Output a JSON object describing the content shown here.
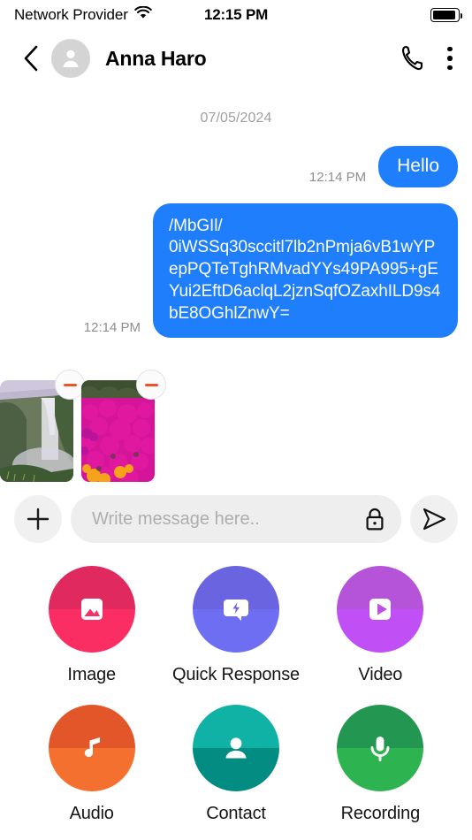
{
  "status_bar": {
    "carrier": "Network Provider",
    "wifi_icon": "wifi-icon",
    "time": "12:15 PM",
    "battery_icon": "battery-icon",
    "battery_level": 92
  },
  "header": {
    "back_icon": "chevron-left-icon",
    "avatar_icon": "person-avatar-icon",
    "contact_name": "Anna Haro",
    "call_icon": "phone-icon",
    "menu_icon": "kebab-menu-icon"
  },
  "conversation": {
    "date_separator": "07/05/2024",
    "messages": [
      {
        "time": "12:14 PM",
        "text": "Hello",
        "direction": "outgoing"
      },
      {
        "time": "12:14 PM",
        "text": "/MbGIl/\n0iWSSq30sccitl7lb2nPmja6vB1wYPepPQTeTghRMvadYYs49PA995+gEYui2EftD6aclqL2jznSqfOZaxhILD9s4bE8OGhlZnwY=",
        "direction": "outgoing"
      }
    ],
    "bubble_color": "#1e7efb",
    "timestamp_color": "#8e8e8e"
  },
  "attachments": {
    "items": [
      {
        "name": "waterfall-photo",
        "remove_icon": "minus-circle-icon"
      },
      {
        "name": "pink-flowers-photo",
        "remove_icon": "minus-circle-icon"
      }
    ],
    "remove_color": "#f0502a"
  },
  "composer": {
    "add_icon": "plus-icon",
    "input_value": "",
    "placeholder": "Write message here..",
    "lock_icon": "lock-icon",
    "send_icon": "send-paper-plane-icon"
  },
  "action_sheet": {
    "items": [
      {
        "label": "Image",
        "icon": "photo-icon",
        "color_top": "#e0295e",
        "color_bottom": "#fa2e63"
      },
      {
        "label": "Quick Response",
        "icon": "lightning-chat-icon",
        "color_top": "#6a64e0",
        "color_bottom": "#6d6ef2"
      },
      {
        "label": "Video",
        "icon": "video-play-icon",
        "color_top": "#b554d8",
        "color_bottom": "#c04ff5"
      },
      {
        "label": "Audio",
        "icon": "music-note-icon",
        "color_top": "#e2562a",
        "color_bottom": "#f4702f"
      },
      {
        "label": "Contact",
        "icon": "person-icon",
        "color_top": "#11b2a6",
        "color_bottom": "#038d82"
      },
      {
        "label": "Recording",
        "icon": "microphone-icon",
        "color_top": "#239651",
        "color_bottom": "#2db34f"
      }
    ]
  }
}
